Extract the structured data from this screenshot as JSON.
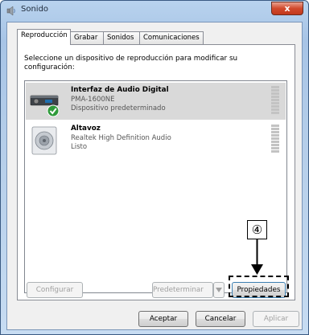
{
  "window": {
    "title": "Sonido",
    "close_label": "x"
  },
  "tabs": [
    {
      "label": "Reproducción",
      "active": true
    },
    {
      "label": "Grabar",
      "active": false
    },
    {
      "label": "Sonidos",
      "active": false
    },
    {
      "label": "Comunicaciones",
      "active": false
    }
  ],
  "instruction": "Seleccione un dispositivo de reproducción para modificar su configuración:",
  "devices": [
    {
      "name": "Interfaz de Audio Digital",
      "model": "PMA-1600NE",
      "status": "Dispositivo predeterminado",
      "selected": true,
      "icon": "digital-audio-interface-icon"
    },
    {
      "name": "Altavoz",
      "model": "Realtek High Definition Audio",
      "status": "Listo",
      "selected": false,
      "icon": "speaker-icon"
    }
  ],
  "buttons": {
    "configure": "Configurar",
    "set_default": "Predeterminar",
    "properties": "Propiedades",
    "accept": "Aceptar",
    "cancel": "Cancelar",
    "apply": "Aplicar"
  },
  "callout": {
    "number": "④"
  },
  "colors": {
    "selected_row": "#d9d9d9",
    "focus_blue": "#3c7fb1"
  }
}
